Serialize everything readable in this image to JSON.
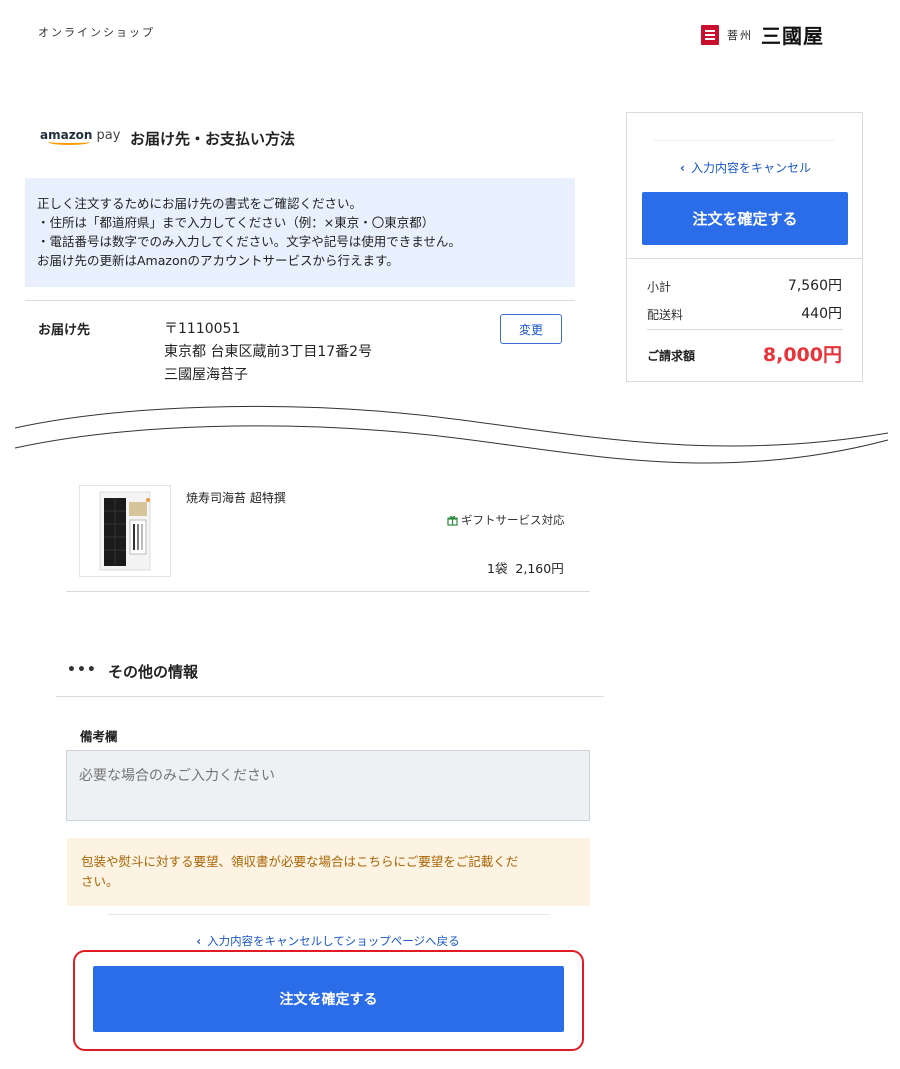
{
  "header": {
    "shop_label": "オンラインショップ",
    "brand": {
      "prefix": "菩州",
      "name": "三國屋"
    }
  },
  "checkout": {
    "amazon_word": "amazon",
    "amazon_pay": "pay",
    "section_title": "お届け先・お支払い方法",
    "notice_lines": [
      "正しく注文するためにお届け先の書式をご確認ください。",
      "・住所は「都道府県」まで入力してください（例：×東京・〇東京都）",
      "・電話番号は数字でのみ入力してください。文字や記号は使用できません。",
      "お届け先の更新はAmazonのアカウントサービスから行えます。"
    ],
    "address": {
      "label": "お届け先",
      "postal": "〒1110051",
      "line1": "東京都 台東区蔵前3丁目17番2号",
      "line2": "三國屋海苔子",
      "change_label": "変更"
    }
  },
  "sidebar": {
    "cancel_label": "入力内容をキャンセル",
    "confirm_label": "注文を確定する",
    "subtotal_label": "小計",
    "subtotal_value": "7,560円",
    "shipping_label": "配送料",
    "shipping_value": "440円",
    "total_label": "ご請求額",
    "total_value": "8,000円"
  },
  "product": {
    "name": "焼寿司海苔 超特撰",
    "gift_label": "ギフトサービス対応",
    "quantity": "1袋",
    "price": "2,160円"
  },
  "other_info": {
    "title": "その他の情報",
    "remarks_label": "備考欄",
    "remarks_placeholder": "必要な場合のみご入力ください",
    "warning_lines": [
      "包装や熨斗に対する要望、領収書が必要な場合はこちらにご要望をご記載くだ",
      "さい。"
    ]
  },
  "footer": {
    "back_label": "入力内容をキャンセルしてショップページへ戻る",
    "confirm_label": "注文を確定する"
  },
  "colors": {
    "primary": "#2b6de8",
    "total_red": "#e8333a",
    "highlight_frame": "#e01b23",
    "notice_bg": "#e8f0fe",
    "warning_bg": "#fdf3e3"
  }
}
